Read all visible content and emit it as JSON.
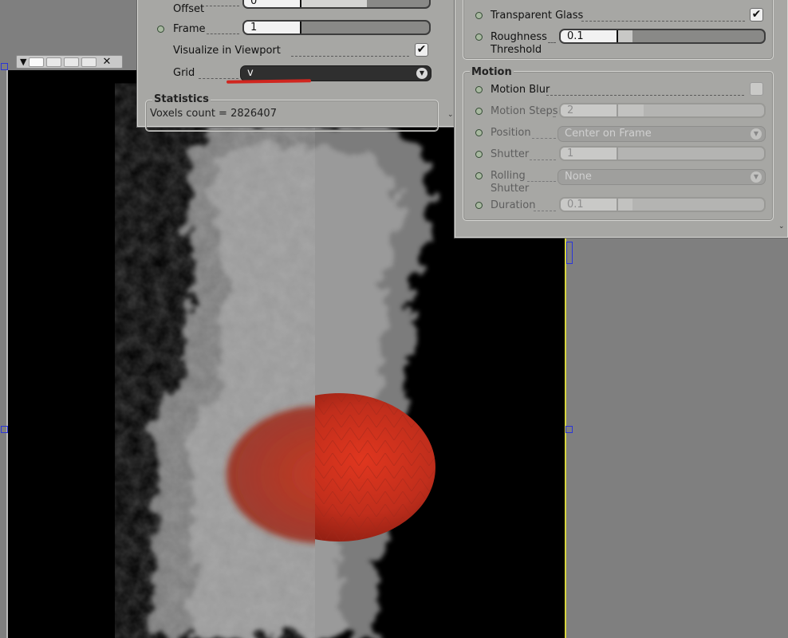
{
  "left_panel": {
    "frame_offset": {
      "label": "Frame\nOffset",
      "value": "0"
    },
    "frame": {
      "label": "Frame",
      "value": "1"
    },
    "visualize": {
      "label": "Visualize in Viewport",
      "checked": true
    },
    "grid": {
      "label": "Grid",
      "value": "v"
    },
    "statistics": {
      "title": "Statistics",
      "voxels_text": "Voxels count = 2826407"
    }
  },
  "right_panel": {
    "transparent_glass": {
      "label": "Transparent Glass",
      "checked": true
    },
    "roughness": {
      "label": "Roughness\nThreshold",
      "value": "0.1"
    },
    "motion": {
      "title": "Motion",
      "motion_blur": {
        "label": "Motion Blur",
        "checked": false
      },
      "motion_steps": {
        "label": "Motion Steps",
        "value": "2"
      },
      "position": {
        "label": "Position",
        "value": "Center on Frame"
      },
      "shutter": {
        "label": "Shutter",
        "value": "1"
      },
      "rolling_shutter": {
        "label": "Rolling\nShutter",
        "value": "None"
      },
      "duration": {
        "label": "Duration",
        "value": "0.1"
      }
    }
  },
  "icons": {
    "led": "green-led-icon",
    "check": "checkmark-icon",
    "dropdown": "dropdown-arrow-icon",
    "close": "close-icon",
    "menu": "triangle-menu-icon"
  },
  "colors": {
    "panel_bg": "#a7a7a4",
    "viewport_bg": "#000000",
    "sphere": "#c8321f",
    "smoke": "#8a8a8a",
    "annotation_red": "#d0261f",
    "selection_handle": "#2a35d8"
  }
}
